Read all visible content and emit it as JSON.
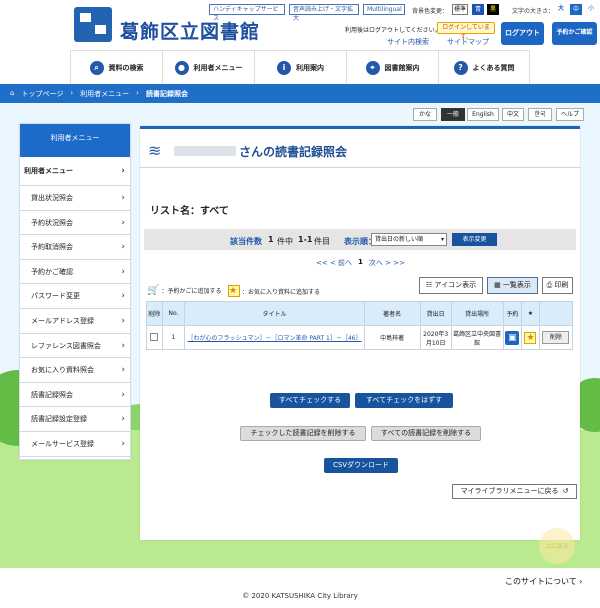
{
  "header": {
    "library_name": "葛飾区立図書館",
    "top_links": [
      "ハンディキャップサービス",
      "音声読み上げ・文字拡大",
      "Multilingual"
    ],
    "color_label": "背景色変更：",
    "color_options": [
      "標準",
      "青",
      "黒"
    ],
    "font_label": "文字の大きさ：",
    "font_options": [
      "大",
      "中",
      "小"
    ],
    "logout_notice": "利用後はログアウトしてください。",
    "login_status": "ログインしています。",
    "site_search": "サイト内検索",
    "sitemap": "サイトマップ",
    "logout_button": "ログアウト",
    "cart_button": "予約かご確認"
  },
  "nav": {
    "items": [
      {
        "label": "資料の検索",
        "icon": "search-icon"
      },
      {
        "label": "利用者メニュー",
        "icon": "user-icon"
      },
      {
        "label": "利用案内",
        "icon": "info-icon"
      },
      {
        "label": "図書館案内",
        "icon": "location-icon"
      },
      {
        "label": "よくある質問",
        "icon": "question-icon"
      }
    ]
  },
  "breadcrumb": [
    "トップページ",
    "利用者メニュー",
    "読書記録照会"
  ],
  "languages": [
    "かな",
    "一般",
    "English",
    "中文",
    "한국",
    "ヘルプ"
  ],
  "sidebar": {
    "header": "利用者メニュー",
    "title": "利用者メニュー",
    "items": [
      "貸出状況照会",
      "予約状況照会",
      "予約取消照会",
      "予約かご確認",
      "パスワード変更",
      "メールアドレス登録",
      "レファレンス図書照会",
      "お気に入り資料照会",
      "読書記録照会",
      "読書記録設定登録",
      "メールサービス登録"
    ]
  },
  "main": {
    "title_suffix": "さんの読書記録照会",
    "list_name": "リスト名：すべて",
    "count_label": "該当件数",
    "count": "1",
    "count_unit": "件中",
    "range": "1-1",
    "range_unit": "件目",
    "sort_label": "表示順：",
    "sort_value": "貸出日の新しい順",
    "sort_button": "表示変更",
    "pager": [
      "<< < 前へ",
      "1",
      "次へ > >>"
    ],
    "legend_cart": "：予約かごに追加する",
    "legend_fav": "：お気に入り資料に追加する",
    "icon_view": "アイコン表示",
    "list_view": "一覧表示",
    "print": "印刷",
    "columns": [
      "削除",
      "No.",
      "タイトル",
      "著者名",
      "貸出日",
      "貸出場所",
      "予約",
      "★",
      ""
    ],
    "rows": [
      {
        "no": "1",
        "title": "［わが心のフラッシュマン］－［ロマン革命 PART 1］－［46］",
        "author": "中島梓著",
        "date": "2020年3月10日",
        "location": "葛飾区立中央図書館",
        "delete_label": "削除"
      }
    ],
    "check_all": "すべてチェックする",
    "uncheck_all": "すべてチェックをはずす",
    "delete_checked": "チェックした読書記録を削除する",
    "delete_all": "すべての読書記録を削除する",
    "csv": "CSVダウンロード",
    "mylibrary": "マイライブラリメニューに戻る"
  },
  "footer": {
    "page_top": "上に戻る",
    "about": "このサイトについて",
    "copyright": "© 2020 KATSUSHIKA City Library"
  }
}
